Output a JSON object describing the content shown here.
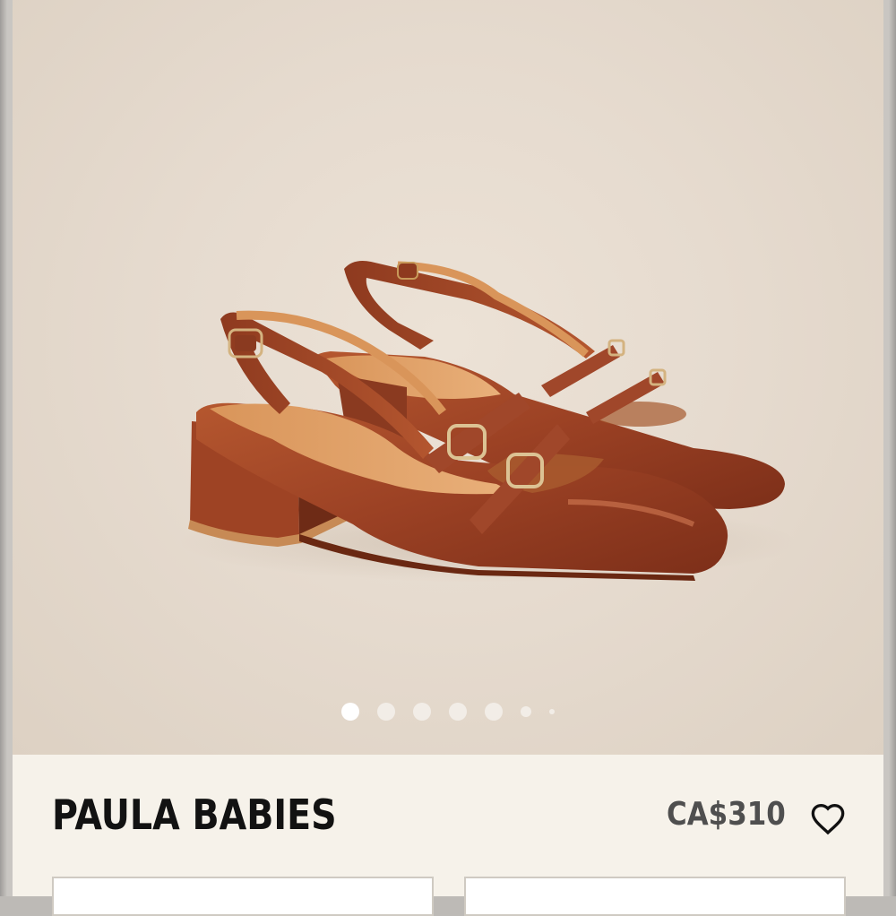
{
  "product": {
    "name": "PAULA BABIES",
    "price": "CA$310"
  },
  "gallery": {
    "image_icon": "shoes-photo",
    "total_slides": 7,
    "active_slide": 1
  },
  "icons": {
    "favorite": "heart-icon"
  },
  "colors": {
    "leather": "#9a4326",
    "background": "#e6dbcf",
    "panel": "#f6f2ea"
  }
}
